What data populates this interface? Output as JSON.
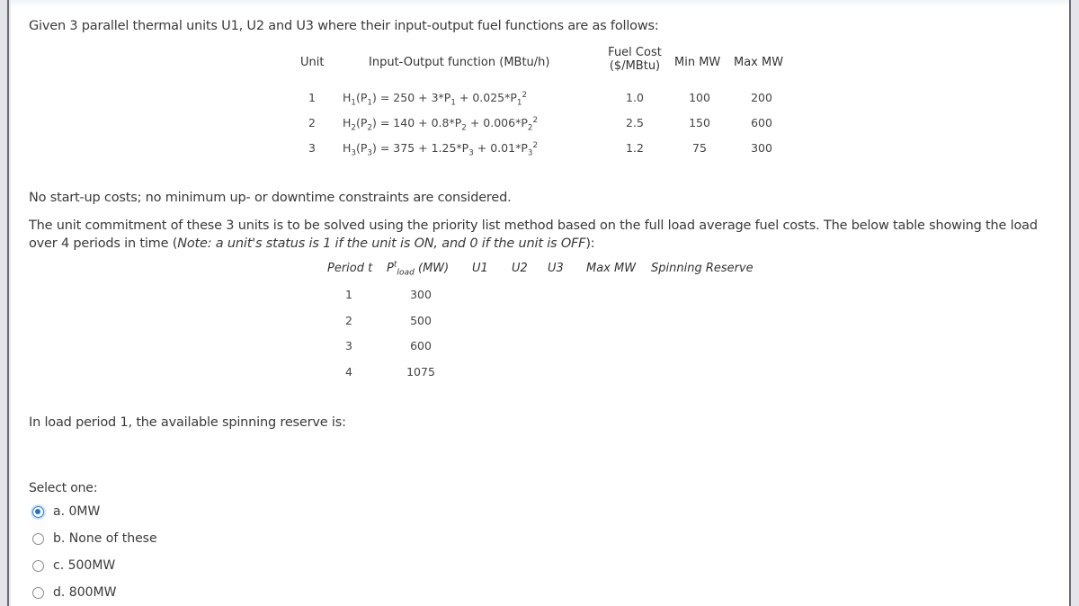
{
  "intro": "Given 3 parallel thermal units U1, U2 and U3 where their input-output fuel functions are as follows:",
  "unit_table": {
    "headers": {
      "unit": "Unit",
      "function": "Input-Output function (MBtu/h)",
      "fuel_cost_line1": "Fuel Cost",
      "fuel_cost_line2": "($/MBtu)",
      "min_mw": "Min MW",
      "max_mw": "Max MW"
    },
    "rows": [
      {
        "unit": "1",
        "fn": {
          "h": "H",
          "i": "1",
          "a": "250",
          "b": "3",
          "c": "0.025"
        },
        "fuel_cost": "1.0",
        "min": "100",
        "max": "200"
      },
      {
        "unit": "2",
        "fn": {
          "h": "H",
          "i": "2",
          "a": "140",
          "b": "0.8",
          "c": "0.006"
        },
        "fuel_cost": "2.5",
        "min": "150",
        "max": "600"
      },
      {
        "unit": "3",
        "fn": {
          "h": "H",
          "i": "3",
          "a": "375",
          "b": "1.25",
          "c": "0.01"
        },
        "fuel_cost": "1.2",
        "min": "75",
        "max": "300"
      }
    ]
  },
  "note": "No start-up costs; no minimum up- or downtime constraints are considered.",
  "paragraph": {
    "text": "The unit commitment of these 3 units is to be solved using the priority list method based on the full load average fuel costs. The below table showing the load over 4 periods in time (",
    "italic": "Note: a unit's status is 1 if the unit is ON, and 0 if the unit is OFF",
    "end": "):"
  },
  "load_table": {
    "headers": {
      "period": "Period t",
      "pload_p": "P",
      "pload_sup": "t",
      "pload_sub": "load",
      "pload_unit": " (MW)",
      "u1": "U1",
      "u2": "U2",
      "u3": "U3",
      "max_mw": "Max MW",
      "spinning": "Spinning Reserve"
    },
    "rows": [
      {
        "period": "1",
        "load": "300"
      },
      {
        "period": "2",
        "load": "500"
      },
      {
        "period": "3",
        "load": "600"
      },
      {
        "period": "4",
        "load": "1075"
      }
    ]
  },
  "question": "In load period 1, the available spinning reserve is:",
  "answer": {
    "select_label": "Select one:",
    "options": [
      {
        "label": "a. 0MW",
        "checked": true
      },
      {
        "label": "b. None of these",
        "checked": false
      },
      {
        "label": "c. 500MW",
        "checked": false
      },
      {
        "label": "d. 800MW",
        "checked": false
      }
    ],
    "accent_color": "#1e73d0"
  }
}
